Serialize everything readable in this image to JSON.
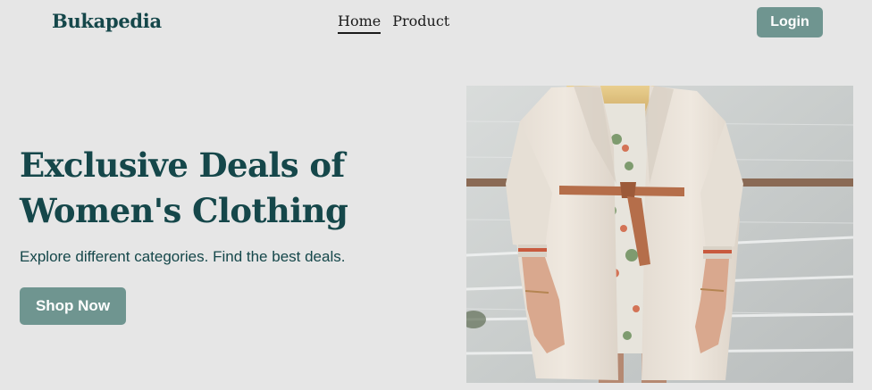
{
  "header": {
    "brand": "Bukapedia",
    "nav": [
      {
        "label": "Home",
        "active": true
      },
      {
        "label": "Product",
        "active": false
      }
    ],
    "login_label": "Login"
  },
  "hero": {
    "title_line1": "Exclusive Deals of",
    "title_line2": "Women's Clothing",
    "subtitle": "Explore different categories. Find the best deals.",
    "cta_label": "Shop Now"
  },
  "colors": {
    "background": "#e6e6e6",
    "brand_text": "#15474a",
    "button_bg": "#6f9590",
    "button_text": "#ffffff"
  }
}
